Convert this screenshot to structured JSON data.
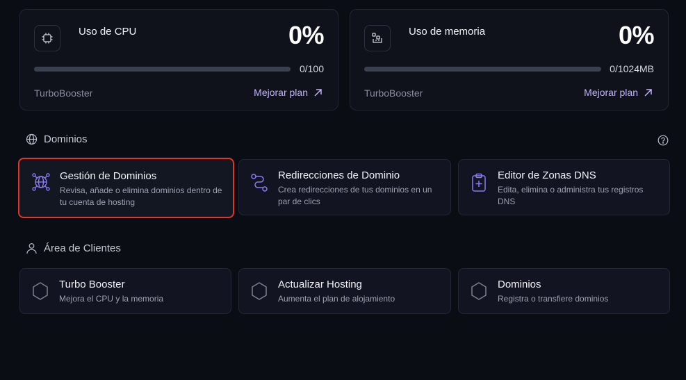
{
  "usage_cards": [
    {
      "title": "Uso de CPU",
      "percent": "0%",
      "value": "0/100",
      "fill_fraction": 0,
      "plan": "TurboBooster",
      "upgrade_label": "Mejorar plan",
      "icon": "cpu-icon"
    },
    {
      "title": "Uso de memoria",
      "percent": "0%",
      "value": "0/1024MB",
      "fill_fraction": 0,
      "plan": "TurboBooster",
      "upgrade_label": "Mejorar plan",
      "icon": "memory-icon"
    }
  ],
  "domains_section": {
    "title": "Dominios",
    "tiles": [
      {
        "title": "Gestión de Dominios",
        "description": "Revisa, añade o elimina dominios dentro de tu cuenta de hosting",
        "icon": "globe-network-icon",
        "selected": true
      },
      {
        "title": "Redirecciones de Dominio",
        "description": "Crea redirecciones de tus dominios en un par de clics",
        "icon": "route-icon"
      },
      {
        "title": "Editor de Zonas DNS",
        "description": "Edita, elimina o administra tus registros DNS",
        "icon": "clipboard-plus-icon"
      }
    ]
  },
  "clients_section": {
    "title": "Área de Clientes",
    "tiles": [
      {
        "title": "Turbo Booster",
        "description": "Mejora el CPU y la memoria",
        "icon": "hexagon-icon"
      },
      {
        "title": "Actualizar Hosting",
        "description": "Aumenta el plan de alojamiento",
        "icon": "hexagon-icon"
      },
      {
        "title": "Dominios",
        "description": "Registra o transfiere dominios",
        "icon": "hexagon-icon"
      }
    ]
  },
  "colors": {
    "accent": "#8b7bf2",
    "link": "#c3b2ff",
    "selected_border": "#e3342a",
    "background": "#0b0d15"
  }
}
